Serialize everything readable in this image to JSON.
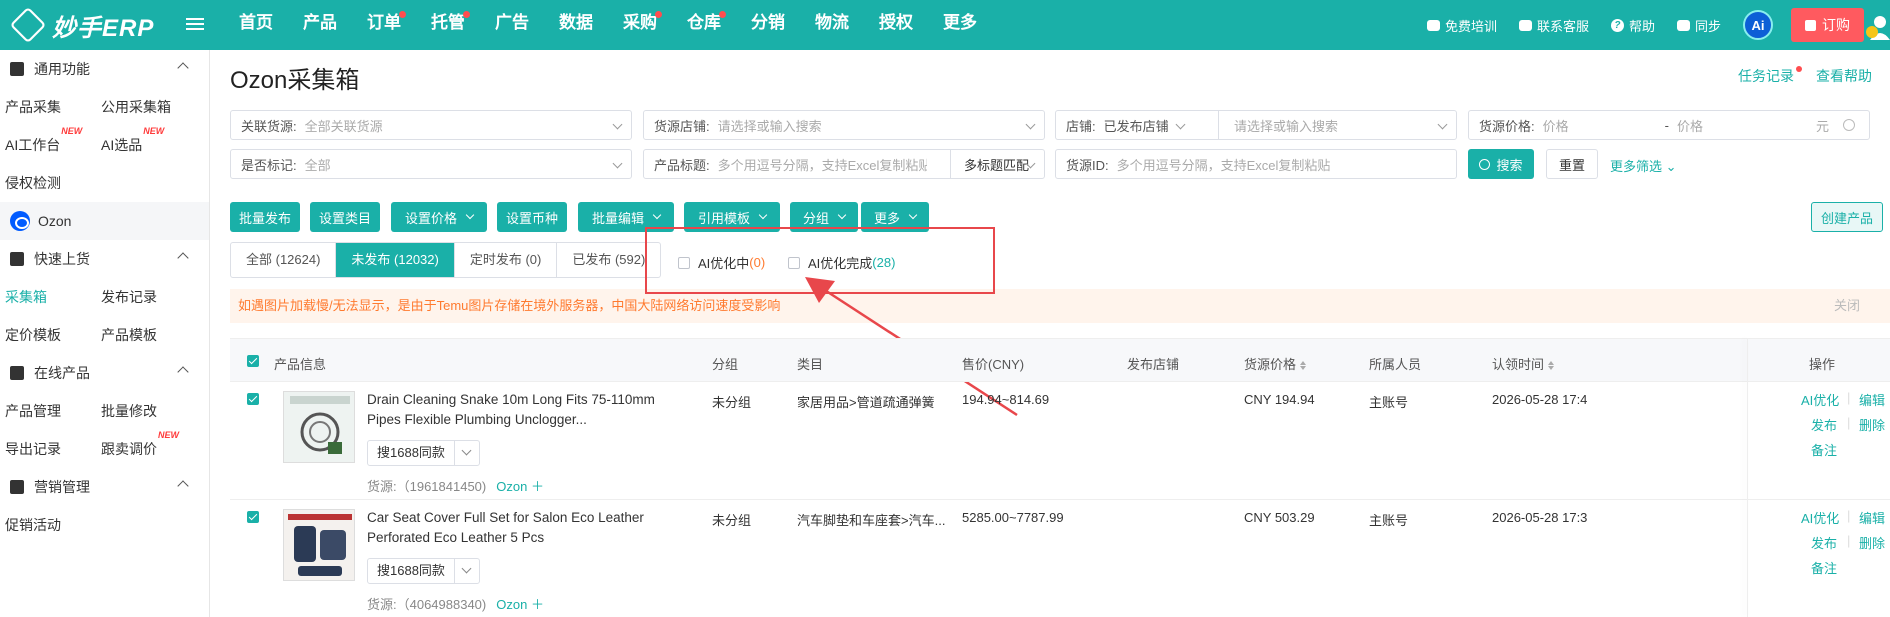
{
  "nav": {
    "logo_text": "妙手ERP",
    "items": [
      {
        "label": "首页",
        "dot": false
      },
      {
        "label": "产品",
        "dot": false
      },
      {
        "label": "订单",
        "dot": true
      },
      {
        "label": "托管",
        "dot": true
      },
      {
        "label": "广告",
        "dot": false
      },
      {
        "label": "数据",
        "dot": false
      },
      {
        "label": "采购",
        "dot": true
      },
      {
        "label": "仓库",
        "dot": true
      },
      {
        "label": "分销",
        "dot": false
      },
      {
        "label": "物流",
        "dot": false
      },
      {
        "label": "授权",
        "dot": false
      },
      {
        "label": "更多",
        "dot": false
      }
    ],
    "training": "免费培训",
    "support": "联系客服",
    "help": "帮助",
    "sync": "同步",
    "ai": "Ai",
    "order": "订购"
  },
  "sidebar": {
    "sec1": "通用功能",
    "common": [
      "产品采集",
      "公用采集箱",
      "AI工作台",
      "AI选品",
      "侵权检测"
    ],
    "new_badge": "NEW",
    "ozon": "Ozon",
    "sec2": "快速上货",
    "quick": [
      "采集箱",
      "发布记录",
      "定价模板",
      "产品模板"
    ],
    "sec3": "在线产品",
    "online": [
      "产品管理",
      "批量修改",
      "导出记录",
      "跟卖调价"
    ],
    "sec4": "营销管理",
    "marketing": [
      "促销活动"
    ]
  },
  "page": {
    "title": "Ozon采集箱",
    "task_log": "任务记录",
    "help": "查看帮助"
  },
  "filters": {
    "source_label": "关联货源:",
    "source_ph": "全部关联货源",
    "store_label": "货源店铺:",
    "store_ph": "请选择或输入搜索",
    "shop_label": "店铺:",
    "shop_val": "已发布店铺",
    "shop_ph": "请选择或输入搜索",
    "price_label": "货源价格:",
    "price_min_ph": "价格",
    "price_dash": "-",
    "price_max_ph": "价格",
    "price_unit": "元",
    "mark_label": "是否标记:",
    "mark_val": "全部",
    "title_label": "产品标题:",
    "title_ph": "多个用逗号分隔，支持Excel复制粘贴",
    "title_match": "多标题匹配",
    "sourceid_label": "货源ID:",
    "sourceid_ph": "多个用逗号分隔，支持Excel复制粘贴",
    "search": "搜索",
    "reset": "重置",
    "more_filters": "更多筛选"
  },
  "toolbar": {
    "batch_publish": "批量发布",
    "set_category": "设置类目",
    "set_price": "设置价格",
    "set_currency": "设置币种",
    "batch_edit": "批量编辑",
    "use_template": "引用模板",
    "group": "分组",
    "more": "更多",
    "create": "创建产品"
  },
  "tabs": [
    {
      "label": "全部 (12624)",
      "active": false
    },
    {
      "label": "未发布 (12032)",
      "active": true
    },
    {
      "label": "定时发布 (0)",
      "active": false
    },
    {
      "label": "已发布 (592)",
      "active": false
    }
  ],
  "ai_filters": {
    "optimizing": "AI优化中",
    "optimizing_count": "(0)",
    "done": "AI优化完成",
    "done_count": "(28)"
  },
  "notice": {
    "text": "如遇图片加载慢/无法显示，是由于Temu图片存储在境外服务器，中国大陆网络访问速度受影响",
    "close": "关闭"
  },
  "table": {
    "headers": {
      "info": "产品信息",
      "group": "分组",
      "category": "类目",
      "price": "售价(CNY)",
      "shop": "发布店铺",
      "source_price": "货源价格",
      "owner": "所属人员",
      "claim_time": "认领时间",
      "ops": "操作"
    },
    "rows": [
      {
        "name": "Drain Cleaning Snake 10m Long Fits 75-110mm Pipes Flexible Plumbing Unclogger...",
        "search_btn": "搜1688同款",
        "source": "货源:（1961841450)",
        "platform": "Ozon",
        "group": "未分组",
        "category": "家居用品>管道疏通弹簧",
        "price": "194.94~814.69",
        "source_price": "CNY 194.94",
        "owner": "主账号",
        "time": "2026-05-28 17:4",
        "op_ai": "AI优化",
        "op_edit": "编辑",
        "op_publish": "发布",
        "op_delete": "删除",
        "op_note": "备注"
      },
      {
        "name": "Car Seat Cover Full Set for Salon Eco Leather Perforated Eco Leather 5 Pcs",
        "search_btn": "搜1688同款",
        "source": "货源:（4064988340)",
        "platform": "Ozon",
        "group": "未分组",
        "category": "汽车脚垫和车座套>汽车...",
        "price": "5285.00~7787.99",
        "source_price": "CNY 503.29",
        "owner": "主账号",
        "time": "2026-05-28 17:3",
        "op_ai": "AI优化",
        "op_edit": "编辑",
        "op_publish": "发布",
        "op_delete": "删除",
        "op_note": "备注"
      }
    ]
  },
  "colors": {
    "brand": "#1ab0a8",
    "annotation": "#e8474b",
    "order": "#ff5a5f"
  }
}
